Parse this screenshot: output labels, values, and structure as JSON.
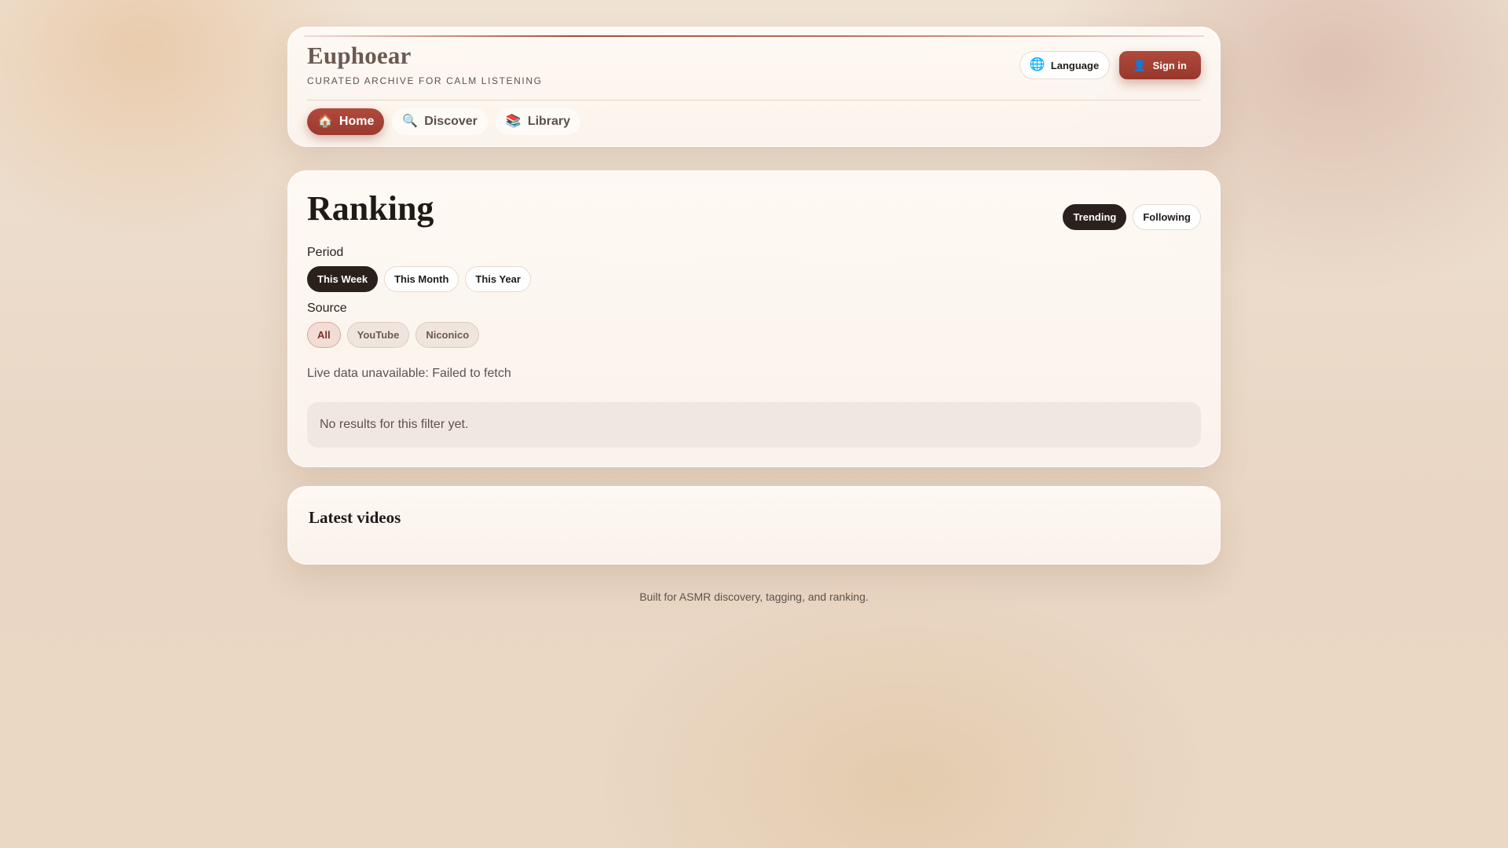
{
  "brand": {
    "title": "Euphoear",
    "subtitle": "CURATED ARCHIVE FOR CALM LISTENING"
  },
  "header_actions": {
    "language_label": "Language",
    "language_icon": "globe-icon",
    "signin_label": "Sign in",
    "signin_icon": "user-icon"
  },
  "nav": {
    "items": [
      {
        "label": "Home",
        "icon": "home-icon",
        "active": true
      },
      {
        "label": "Discover",
        "icon": "search-icon",
        "active": false
      },
      {
        "label": "Library",
        "icon": "books-icon",
        "active": false
      }
    ]
  },
  "ranking": {
    "title": "Ranking",
    "tabs": [
      {
        "label": "Trending",
        "selected": true
      },
      {
        "label": "Following",
        "selected": false
      }
    ],
    "period_label": "Period",
    "period_options": [
      {
        "label": "This Week",
        "selected": true
      },
      {
        "label": "This Month",
        "selected": false
      },
      {
        "label": "This Year",
        "selected": false
      }
    ],
    "source_label": "Source",
    "source_options": [
      {
        "label": "All",
        "selected": true
      },
      {
        "label": "YouTube",
        "selected": false
      },
      {
        "label": "Niconico",
        "selected": false
      }
    ],
    "status_message": "Live data unavailable: Failed to fetch",
    "empty_message": "No results for this filter yet."
  },
  "latest": {
    "title": "Latest videos"
  },
  "footer": {
    "text": "Built for ASMR discovery, tagging, and ranking."
  },
  "colors": {
    "accent": "#a94a3a",
    "dark_pill": "#2a211d",
    "background": "#ecdccb"
  }
}
